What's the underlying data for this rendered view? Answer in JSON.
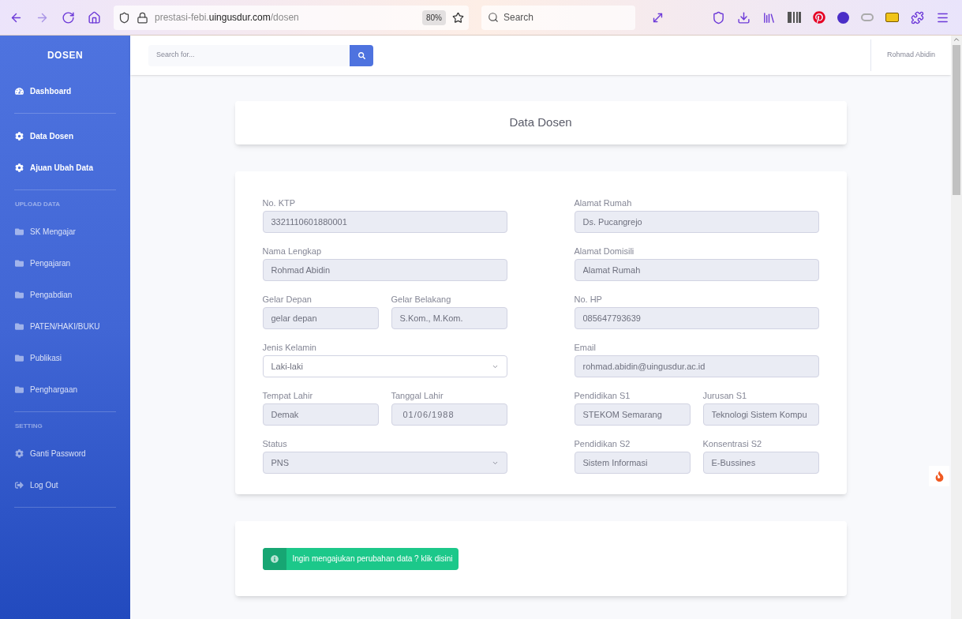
{
  "browser": {
    "url": {
      "prefix": "prestasi-febi.",
      "host": "uingusdur.com",
      "path": "/dosen"
    },
    "zoom": "80%",
    "search": {
      "placeholder": "Search"
    }
  },
  "sidebar": {
    "brand": "DOSEN",
    "items": [
      {
        "kind": "dashboard",
        "label": "Dashboard"
      },
      {
        "kind": "divider"
      },
      {
        "kind": "menu",
        "label": "Data Dosen"
      },
      {
        "kind": "menu",
        "label": "Ajuan Ubah Data"
      },
      {
        "kind": "divider"
      },
      {
        "kind": "heading",
        "label": "UPLOAD DATA"
      },
      {
        "kind": "folder",
        "label": "SK Mengajar"
      },
      {
        "kind": "folder",
        "label": "Pengajaran"
      },
      {
        "kind": "folder",
        "label": "Pengabdian"
      },
      {
        "kind": "folder",
        "label": "PATEN/HAKI/BUKU"
      },
      {
        "kind": "folder",
        "label": "Publikasi"
      },
      {
        "kind": "folder",
        "label": "Penghargaan"
      },
      {
        "kind": "divider"
      },
      {
        "kind": "heading",
        "label": "SETTING"
      },
      {
        "kind": "setting",
        "label": "Ganti Password"
      },
      {
        "kind": "logout",
        "label": "Log Out"
      },
      {
        "kind": "divider"
      }
    ]
  },
  "topbar": {
    "search": {
      "placeholder": "Search for..."
    },
    "user": "Rohmad Abidin"
  },
  "title": "Data Dosen",
  "form": {
    "left": [
      [
        {
          "label": "No. KTP",
          "value": "3321110601880001",
          "kind": "input",
          "disabled": true
        }
      ],
      [
        {
          "label": "Nama Lengkap",
          "value": "Rohmad Abidin",
          "kind": "input",
          "disabled": true
        }
      ],
      [
        {
          "label": "Gelar Depan",
          "placeholder": "gelar depan",
          "kind": "input",
          "disabled": true
        },
        {
          "label": "Gelar Belakang",
          "value": "S.Kom., M.Kom.",
          "kind": "input",
          "disabled": true
        }
      ],
      [
        {
          "label": "Jenis Kelamin",
          "value": "Laki-laki",
          "kind": "select",
          "disabled": false
        }
      ],
      [
        {
          "label": "Tempat Lahir",
          "value": "Demak",
          "kind": "input",
          "disabled": true
        },
        {
          "label": "Tanggal Lahir",
          "value": "01/06/1988",
          "kind": "date",
          "disabled": true
        }
      ],
      [
        {
          "label": "Status",
          "value": "PNS",
          "kind": "select",
          "disabled": true
        }
      ]
    ],
    "right": [
      [
        {
          "label": "Alamat Rumah",
          "value": "Ds. Pucangrejo",
          "kind": "input",
          "disabled": true
        }
      ],
      [
        {
          "label": "Alamat Domisili",
          "placeholder": "Alamat Rumah",
          "kind": "input",
          "disabled": true
        }
      ],
      [
        {
          "label": "No. HP",
          "value": "085647793639",
          "kind": "input",
          "disabled": true
        }
      ],
      [
        {
          "label": "Email",
          "value": "rohmad.abidin@uingusdur.ac.id",
          "kind": "input",
          "disabled": true
        }
      ],
      [
        {
          "label": "Pendidikan S1",
          "value": "STEKOM Semarang",
          "kind": "input",
          "disabled": true
        },
        {
          "label": "Jurusan S1",
          "value": "Teknologi Sistem Kompu",
          "kind": "input",
          "disabled": true
        }
      ],
      [
        {
          "label": "Pendidikan S2",
          "value": "Sistem Informasi",
          "kind": "input",
          "disabled": true
        },
        {
          "label": "Konsentrasi S2",
          "value": "E-Bussines",
          "kind": "input",
          "disabled": true
        }
      ]
    ]
  },
  "action": {
    "label": "Ingin mengajukan perubahan data ? klik disini"
  }
}
